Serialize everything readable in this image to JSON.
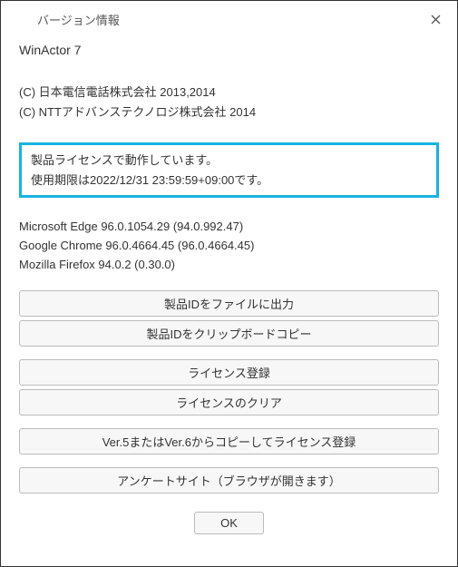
{
  "titlebar": {
    "title": "バージョン情報"
  },
  "product": {
    "name": "WinActor 7"
  },
  "copyright": {
    "line1": "(C) 日本電信電話株式会社 2013,2014",
    "line2": "(C) NTTアドバンステクノロジ株式会社 2014"
  },
  "license": {
    "status": "製品ライセンスで動作しています。",
    "expiry": "使用期限は2022/12/31 23:59:59+09:00です。"
  },
  "browsers": {
    "edge": "Microsoft Edge 96.0.1054.29 (94.0.992.47)",
    "chrome": "Google Chrome 96.0.4664.45 (96.0.4664.45)",
    "firefox": "Mozilla Firefox 94.0.2 (0.30.0)"
  },
  "buttons": {
    "export_file": "製品IDをファイルに出力",
    "copy_clipboard": "製品IDをクリップボードコピー",
    "register_license": "ライセンス登録",
    "clear_license": "ライセンスのクリア",
    "copy_from_v5v6": "Ver.5またはVer.6からコピーしてライセンス登録",
    "survey_site": "アンケートサイト（ブラウザが開きます）",
    "ok": "OK"
  },
  "colors": {
    "highlight_border": "#17b3e0"
  }
}
